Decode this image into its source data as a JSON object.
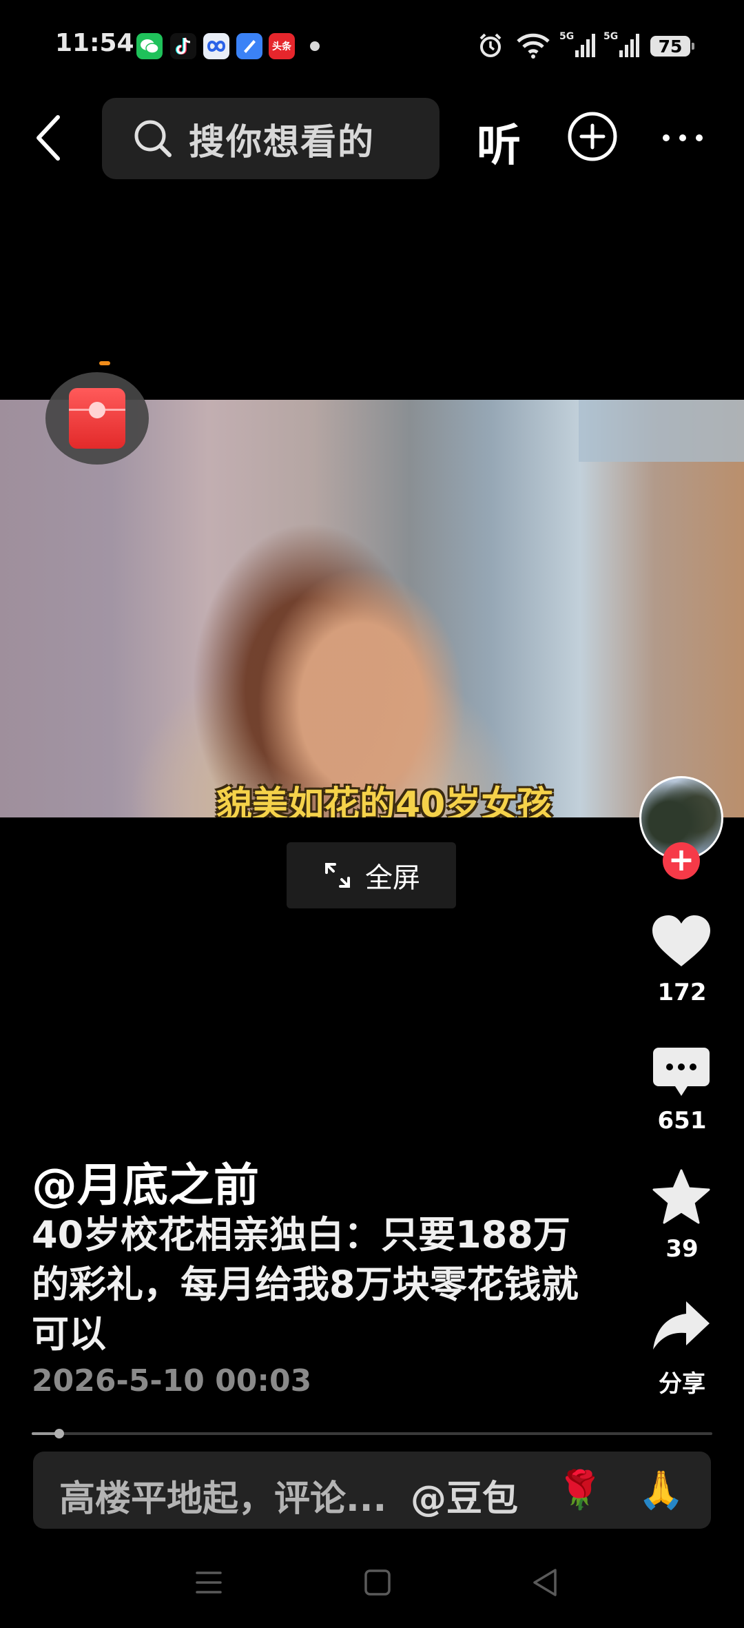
{
  "status_bar": {
    "time": "11:54",
    "apps": [
      {
        "name": "wechat-icon",
        "color": "#1fc15a",
        "glyph": "💬"
      },
      {
        "name": "tiktok-icon",
        "color": "#111111",
        "glyph": "♪"
      },
      {
        "name": "baidu-netdisk-icon",
        "color": "#e9eef7",
        "glyph": "∞"
      },
      {
        "name": "app-blue-icon",
        "color": "#3b82f6",
        "glyph": "✎"
      },
      {
        "name": "toutiao-icon",
        "color": "#e6262c",
        "glyph": "头条"
      }
    ],
    "network_1": "5G",
    "network_2": "5G",
    "battery": "75"
  },
  "top_bar": {
    "search_placeholder": "搜你想看的",
    "listen_label": "听"
  },
  "video": {
    "subtitle": "貌美如花的40岁女孩",
    "fullscreen_label": "全屏"
  },
  "actions": {
    "likes": "172",
    "comments": "651",
    "favorites": "39",
    "share_label": "分享"
  },
  "post": {
    "author": "@月底之前",
    "description": "40岁校花相亲独白：只要188万的彩礼，每月给我8万块零花钱就可以",
    "date": "2026-5-10 00:03",
    "progress": 0.04
  },
  "comment_bar": {
    "placeholder": "高楼平地起，评论...",
    "mention": "@豆包",
    "emoji_1": "🌹",
    "emoji_2": "🙏"
  },
  "colors": {
    "follow_red": "#f63a48",
    "subtitle_yellow": "#f5d24a",
    "redpacket_red": "#e22a2a"
  }
}
